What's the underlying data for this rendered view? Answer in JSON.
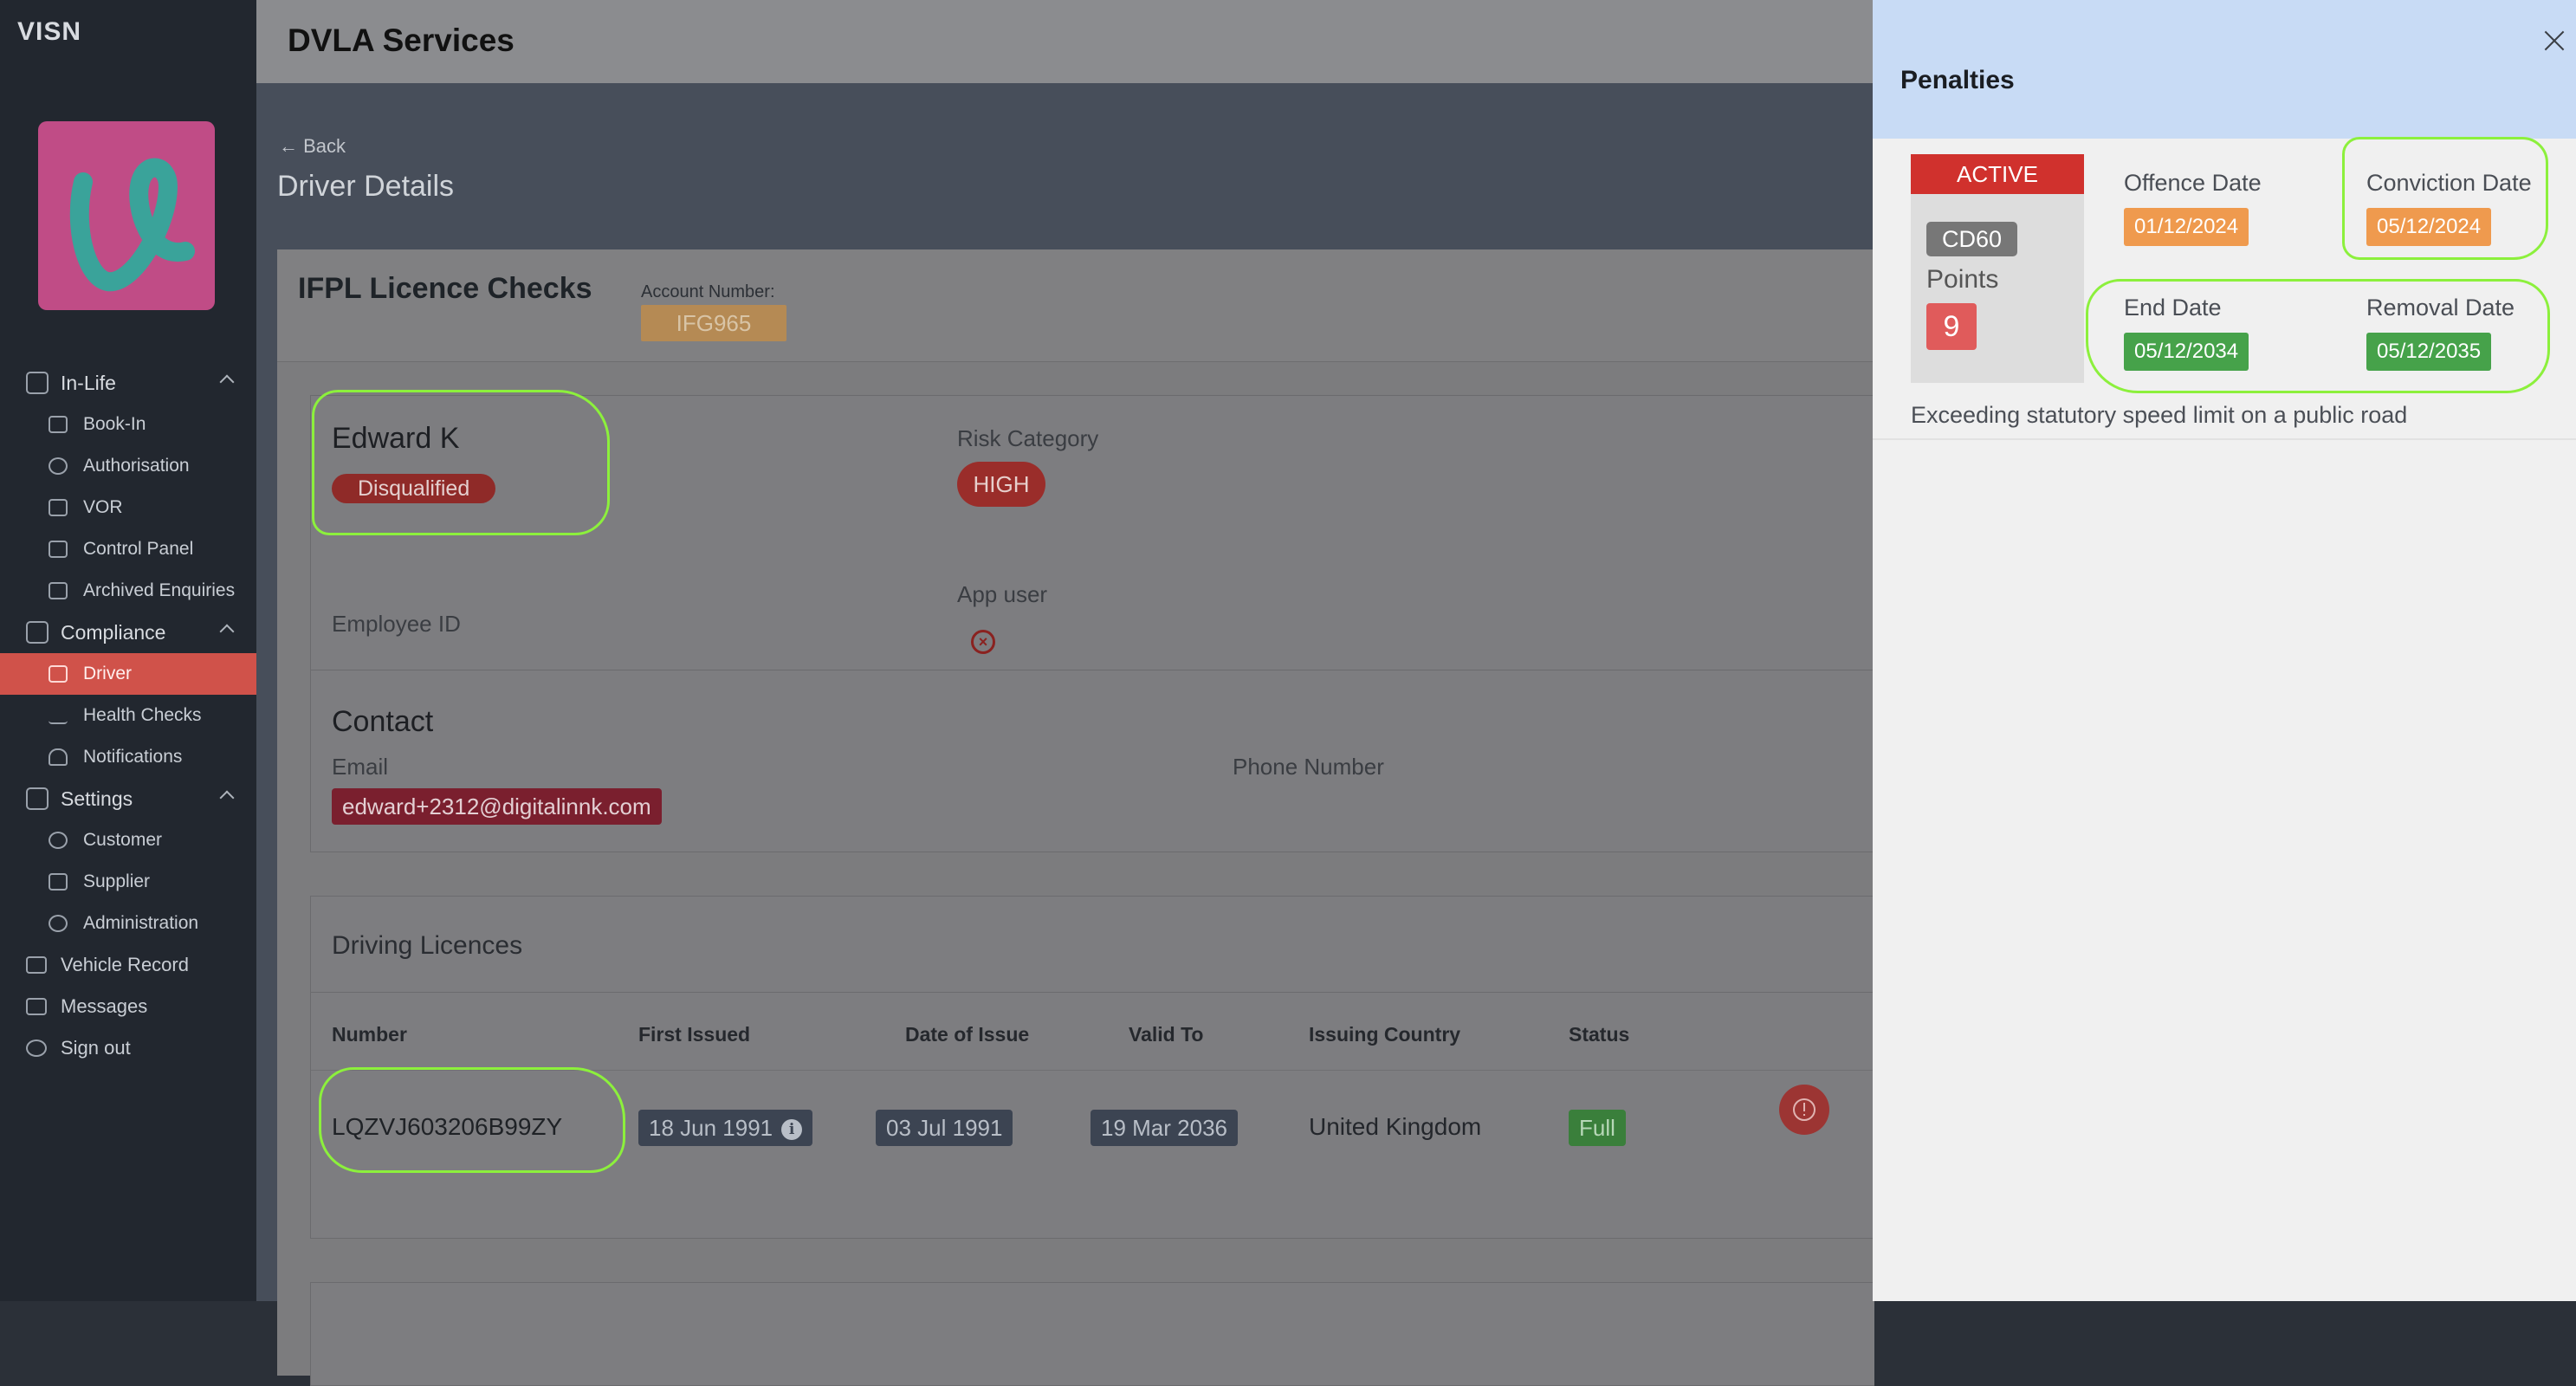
{
  "app": {
    "brand": "VISN",
    "header_title": "DVLA Services"
  },
  "sidebar": {
    "groups": [
      {
        "label": "In-Life",
        "items": [
          "Book-In",
          "Authorisation",
          "VOR",
          "Control Panel",
          "Archived Enquiries"
        ]
      },
      {
        "label": "Compliance",
        "items": [
          "Driver",
          "Health Checks",
          "Notifications"
        ]
      },
      {
        "label": "Settings",
        "items": [
          "Customer",
          "Supplier",
          "Administration"
        ]
      }
    ],
    "extra": [
      "Vehicle Record",
      "Messages",
      "Sign out"
    ],
    "active_item": "Driver"
  },
  "page": {
    "back_label": "Back",
    "title": "Driver Details"
  },
  "card": {
    "title": "IFPL Licence Checks",
    "account_label": "Account Number:",
    "account_value": "IFG965"
  },
  "driver": {
    "name": "Edward K",
    "status": "Disqualified",
    "risk_label": "Risk Category",
    "risk_value": "HIGH",
    "employee_id_label": "Employee ID",
    "app_user_label": "App user",
    "app_user_icon": "x-circle-icon"
  },
  "contact": {
    "title": "Contact",
    "email_label": "Email",
    "email_value": "edward+2312@digitalinnk.com",
    "phone_label": "Phone Number"
  },
  "licences": {
    "title": "Driving Licences",
    "columns": [
      "Number",
      "First Issued",
      "Date of Issue",
      "Valid To",
      "Issuing Country",
      "Status"
    ],
    "rows": [
      {
        "number": "LQZVJ603206B99ZY",
        "first_issued": "18 Jun 1991",
        "date_of_issue": "03 Jul 1991",
        "valid_to": "19 Mar 2036",
        "country": "United Kingdom",
        "status": "Full"
      }
    ]
  },
  "drawer": {
    "title": "Penalties",
    "penalty": {
      "status": "ACTIVE",
      "code": "CD60",
      "points_label": "Points",
      "points": "9",
      "offence_date_label": "Offence Date",
      "offence_date": "01/12/2024",
      "conviction_date_label": "Conviction Date",
      "conviction_date": "05/12/2024",
      "end_date_label": "End Date",
      "end_date": "05/12/2034",
      "removal_date_label": "Removal Date",
      "removal_date": "05/12/2035",
      "description": "Exceeding statutory speed limit on a public road"
    }
  },
  "colors": {
    "active_nav": "#d0524a",
    "drawer_header": "#c8dbf5",
    "active_badge": "#d0312d",
    "date_orange": "#ef9a4e",
    "date_green": "#46a24a",
    "highlight": "#8cf03c"
  }
}
